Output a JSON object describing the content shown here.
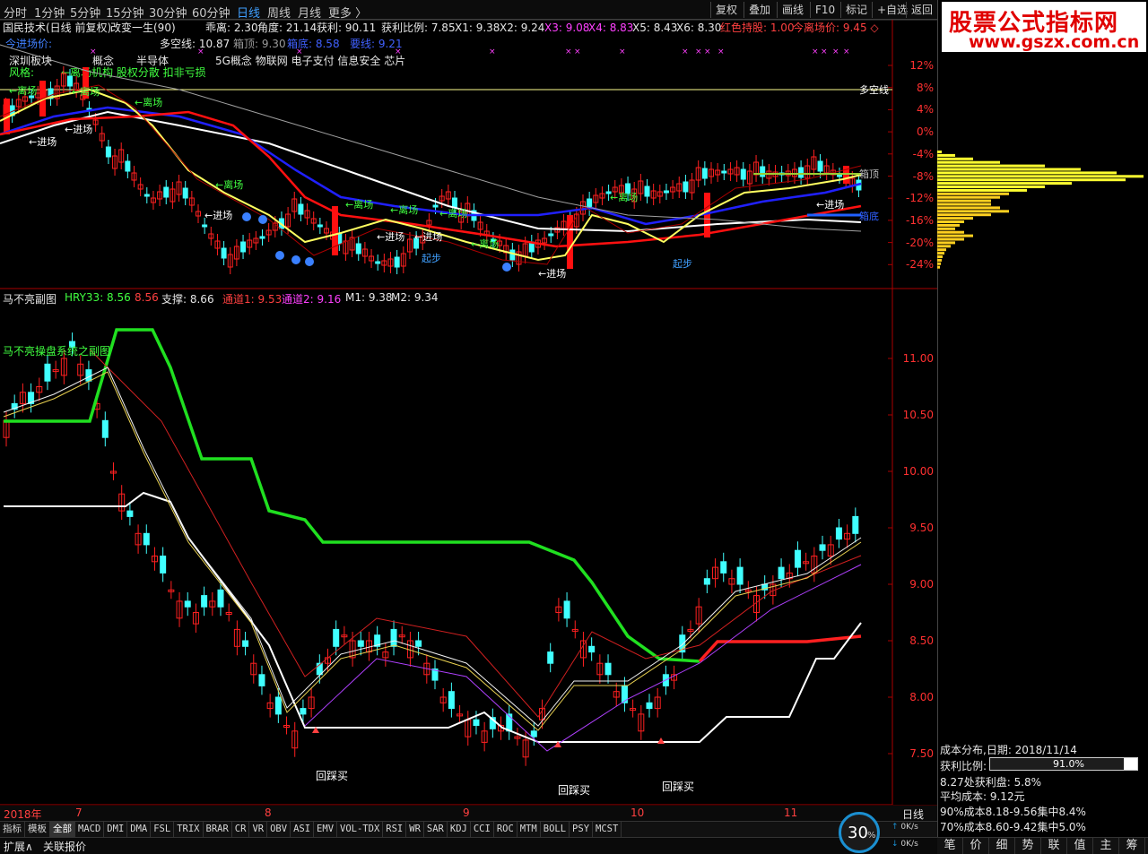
{
  "topbar": {
    "periods": [
      "分时",
      "1分钟",
      "5分钟",
      "15分钟",
      "30分钟",
      "60分钟",
      "日线",
      "周线",
      "月线",
      "更多 〉"
    ],
    "active": "日线",
    "buttons": [
      "复权",
      "叠加",
      "画线",
      "F10",
      "标记",
      "+自选",
      "返回"
    ]
  },
  "title": {
    "name": "国民技术(日线 前复权)",
    "formula": "改变一生(90)"
  },
  "info1": {
    "gl": "乖离: 2.30",
    "jd": "角度: 21.14",
    "hl": "获利: 90.11",
    "hlbl": "获利比例: 7.85",
    "x1": "X1: 9.38",
    "x2": "X2: 9.24",
    "x3": "X3: 9.08",
    "x4": "X4: 8.83",
    "x5": "X5: 8.43",
    "x6": "X6: 8.30",
    "hscg": "红色持股: 1.00",
    "jlcj": "今离场价: 9.45 ◇"
  },
  "info2": {
    "jcj": "今进场价:",
    "dkx": "多空线: 10.87",
    "xd": "箱顶: 9.30",
    "xdi": "箱底: 8.58",
    "ysx": "要线: 9.21"
  },
  "sector": {
    "row1a": "深圳板块",
    "row1b": "概念",
    "row1c": "半导体",
    "row2": "5G概念 物联网 电子支付 信息安全 芯片",
    "row3": "风格:",
    "row3b": "←离场机构 股权分散 扣非亏损"
  },
  "labels": {
    "dkx_line": "多空线",
    "xiangding": "箱顶",
    "xiangdi": "箱底",
    "jinchang": "进场",
    "lichang": "离场",
    "qibu": "起步"
  },
  "annot": {
    "jinchang": [
      "←进场",
      "←进场",
      "←进场",
      "←进场",
      "←进场",
      "←进场",
      "←进场"
    ],
    "lichang": [
      "←离场",
      "←离场",
      "←离场",
      "←离场",
      "←离场",
      "←离场",
      "←离场",
      "←离场",
      "←离场"
    ],
    "qibu": [
      "起步",
      "起步"
    ],
    "bottom": [
      "进场",
      "进场",
      "进场"
    ]
  },
  "upper_axis": [
    "12%",
    "8%",
    "4%",
    "0%",
    "-4%",
    "-8%",
    "-12%",
    "-16%",
    "-20%",
    "-24%"
  ],
  "lower_info": {
    "name": "马不亮副图",
    "hry": "HRY33: 8.56",
    "hry2": "8.56",
    "zc": "支撑: 8.66",
    "td1": "通道1: 9.53",
    "td2": "通道2: 9.16",
    "m1": "M1: 9.38",
    "m2": "M2: 9.34"
  },
  "lower_title": "马不亮操盘系统之副图",
  "lower_axis": [
    "11.00",
    "10.50",
    "10.00",
    "9.50",
    "9.00",
    "8.50",
    "8.00",
    "7.50"
  ],
  "huizhang": [
    "回踩买",
    "回踩买",
    "回踩买"
  ],
  "date_axis": {
    "year": "2018年",
    "months": [
      "7",
      "8",
      "9",
      "10",
      "11"
    ],
    "period": "日线"
  },
  "tabs": [
    "指标",
    "模板",
    "全部",
    "MACD",
    "DMI",
    "DMA",
    "FSL",
    "TRIX",
    "BRAR",
    "CR",
    "VR",
    "OBV",
    "ASI",
    "EMV",
    "VOL-TDX",
    "RSI",
    "WR",
    "SAR",
    "KDJ",
    "CCI",
    "ROC",
    "MTM",
    "BOLL",
    "PSY",
    "MCST"
  ],
  "active_tab": "全部",
  "status": {
    "expand": "扩展∧",
    "quote": "关联报价",
    "pct": "30",
    "pct_unit": "%",
    "speed1": "0K/s",
    "speed2": "0K/s"
  },
  "logo": {
    "line1": "股票公式指标网",
    "line2": "www.gszx.com.cn"
  },
  "cost": {
    "title": "成本分布,日期: 2018/11/14",
    "hlbl_label": "获利比例:",
    "hlbl_val": "91.0%",
    "l1": "8.27处获利盘: 5.8%",
    "l2": "平均成本: 9.12元",
    "l3": "90%成本8.18-9.56集中8.4%",
    "l4": "70%成本8.60-9.42集中5.0%"
  },
  "rtabs": [
    "笔",
    "价",
    "细",
    "势",
    "联",
    "值",
    "主",
    "筹"
  ],
  "colors": {
    "up": "#ff2020",
    "down": "#40ffff",
    "dkx": "#ffffff",
    "ma_blue": "#2020ff",
    "ma_red": "#ff2020",
    "ma_yellow": "#ffff60",
    "green_band": "#20e020"
  }
}
